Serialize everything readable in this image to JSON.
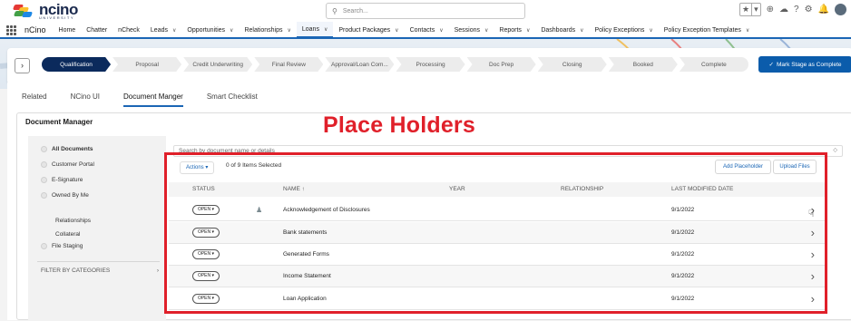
{
  "header": {
    "logo_word": "ncino",
    "logo_sub": "UNIVERSITY",
    "search_placeholder": "Search...",
    "search_icon": "search-icon",
    "fav_star": "★",
    "fav_caret": "▾",
    "icons": [
      "add-icon",
      "trailhead-icon",
      "help-icon",
      "gear-icon",
      "bell-icon",
      "avatar"
    ]
  },
  "nav": {
    "app_name": "nCino",
    "items": [
      {
        "label": "Home",
        "chevron": false
      },
      {
        "label": "Chatter",
        "chevron": false
      },
      {
        "label": "nCheck",
        "chevron": false
      },
      {
        "label": "Leads",
        "chevron": true
      },
      {
        "label": "Opportunities",
        "chevron": true
      },
      {
        "label": "Relationships",
        "chevron": true
      },
      {
        "label": "Loans",
        "chevron": true,
        "active": true
      },
      {
        "label": "Product Packages",
        "chevron": true
      },
      {
        "label": "Contacts",
        "chevron": true
      },
      {
        "label": "Sessions",
        "chevron": true
      },
      {
        "label": "Reports",
        "chevron": true
      },
      {
        "label": "Dashboards",
        "chevron": true
      },
      {
        "label": "Policy Exceptions",
        "chevron": true
      },
      {
        "label": "Policy Exception Templates",
        "chevron": true
      }
    ]
  },
  "path": {
    "toggle": "›",
    "steps": [
      "Qualification",
      "Proposal",
      "Credit Underwriting",
      "Final Review",
      "Approval/Loan Com...",
      "Processing",
      "Doc Prep",
      "Closing",
      "Booked",
      "Complete"
    ],
    "current": 0,
    "mark_button": "Mark Stage as Complete"
  },
  "tabs": [
    "Related",
    "NCino UI",
    "Document Manger",
    "Smart Checklist"
  ],
  "active_tab": 2,
  "doc_manager": {
    "title": "Document Manager",
    "sidebar": {
      "items": [
        "All Documents",
        "Customer Portal",
        "E-Signature",
        "Owned By Me"
      ],
      "sub_items": [
        "Relationships",
        "Collateral"
      ],
      "file_staging": "File Staging",
      "filter": "FILTER BY CATEGORIES",
      "filter_chevron": "›"
    },
    "search_placeholder": "Search by document name or details",
    "search_caret": "◇",
    "actions_label": "Actions ▾",
    "selected_text": "0 of 9 Items Selected",
    "add_placeholder": "Add Placeholder",
    "upload_files": "Upload Files",
    "columns": [
      "STATUS",
      "NAME ↑",
      "YEAR",
      "RELATIONSHIP",
      "LAST MODIFIED DATE"
    ],
    "rows": [
      {
        "status": "OPEN ▾",
        "name": "Acknowledgement of Disclosures",
        "year": "",
        "relationship": "",
        "date": "9/1/2022",
        "icon": true
      },
      {
        "status": "OPEN ▾",
        "name": "Bank statements",
        "year": "",
        "relationship": "",
        "date": "9/1/2022",
        "icon": false
      },
      {
        "status": "OPEN ▾",
        "name": "Generated Forms",
        "year": "",
        "relationship": "",
        "date": "9/1/2022",
        "icon": false
      },
      {
        "status": "OPEN ▾",
        "name": "Income Statement",
        "year": "",
        "relationship": "",
        "date": "9/1/2022",
        "icon": false
      },
      {
        "status": "OPEN ▾",
        "name": "Loan Application",
        "year": "",
        "relationship": "",
        "date": "9/1/2022",
        "icon": false
      }
    ],
    "row_chevron": "›"
  },
  "annotation": {
    "label": "Place Holders",
    "color": "#e0202a"
  },
  "colors": {
    "brand_navy": "#0b2a5c",
    "primary_blue": "#0b5cab",
    "link_blue": "#1b66b5"
  }
}
